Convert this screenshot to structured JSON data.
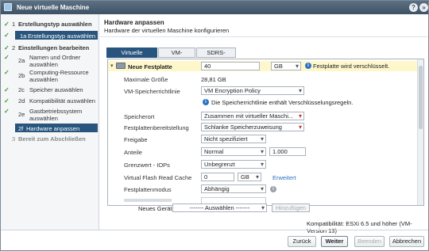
{
  "window": {
    "title": "Neue virtuelle Maschine"
  },
  "steps": [
    {
      "num": "1",
      "label": "Erstellungstyp auswählen",
      "done": true,
      "main": true
    },
    {
      "num": "1a",
      "label": "Erstellungstyp auswählen",
      "done": true,
      "active": true
    },
    {
      "num": "2",
      "label": "Einstellungen bearbeiten",
      "done": true,
      "main": true
    },
    {
      "num": "2a",
      "label": "Namen und Ordner auswählen",
      "done": true
    },
    {
      "num": "2b",
      "label": "Computing-Ressource auswählen",
      "done": true
    },
    {
      "num": "2c",
      "label": "Speicher auswählen",
      "done": true
    },
    {
      "num": "2d",
      "label": "Kompatibilität auswählen",
      "done": true
    },
    {
      "num": "2e",
      "label": "Gastbetriebssystem auswählen",
      "done": true
    },
    {
      "num": "2f",
      "label": "Hardware anpassen",
      "active": true
    },
    {
      "num": "3",
      "label": "Bereit zum Abschließen",
      "main": true,
      "dim": true
    }
  ],
  "header": {
    "title": "Hardware anpassen",
    "subtitle": "Hardware der virtuellen Maschine konfigurieren"
  },
  "tabs": [
    "Virtuelle Hardware",
    "VM-Optionen",
    "SDRS-Regeln"
  ],
  "disk": {
    "label": "Neue Festplatte",
    "size": "40",
    "unit": "GB",
    "encrypt_note": "Festplatte wird verschlüsselt."
  },
  "rows": {
    "max_size_label": "Maximale Größe",
    "max_size_value": "28,81 GB",
    "policy_label": "VM-Speicherrichtlinie",
    "policy_value": "VM Encryption Policy",
    "policy_note": "Die Speicherrichtlinie enthält Verschlüsselungsregeln.",
    "location_label": "Speicherort",
    "location_value": "Zusammen mit virtueller Maschi...",
    "provision_label": "Festplattenbereitstellung",
    "provision_value": "Schlanke Speicherzuweisung",
    "sharing_label": "Freigabe",
    "sharing_value": "Nicht spezifiziert",
    "shares_label": "Anteile",
    "shares_value": "Normal",
    "shares_number": "1.000",
    "iops_label": "Grenzwert - IOPs",
    "iops_value": "Unbegrenzt",
    "vflash_label": "Virtual Flash Read Cache",
    "vflash_value": "0",
    "vflash_unit": "GB",
    "vflash_link": "Erweitert",
    "mode_label": "Festplattenmodus",
    "mode_value": "Abhängig"
  },
  "new_device": {
    "label": "Neues Gerät:",
    "select": "------- Auswählen -------",
    "add_button": "Hinzufügen"
  },
  "compat": "Kompatibilität: ESXi 6.5 und höher (VM-Version 13)",
  "buttons": {
    "back": "Zurück",
    "next": "Weiter",
    "finish": "Beenden",
    "cancel": "Abbrechen"
  }
}
